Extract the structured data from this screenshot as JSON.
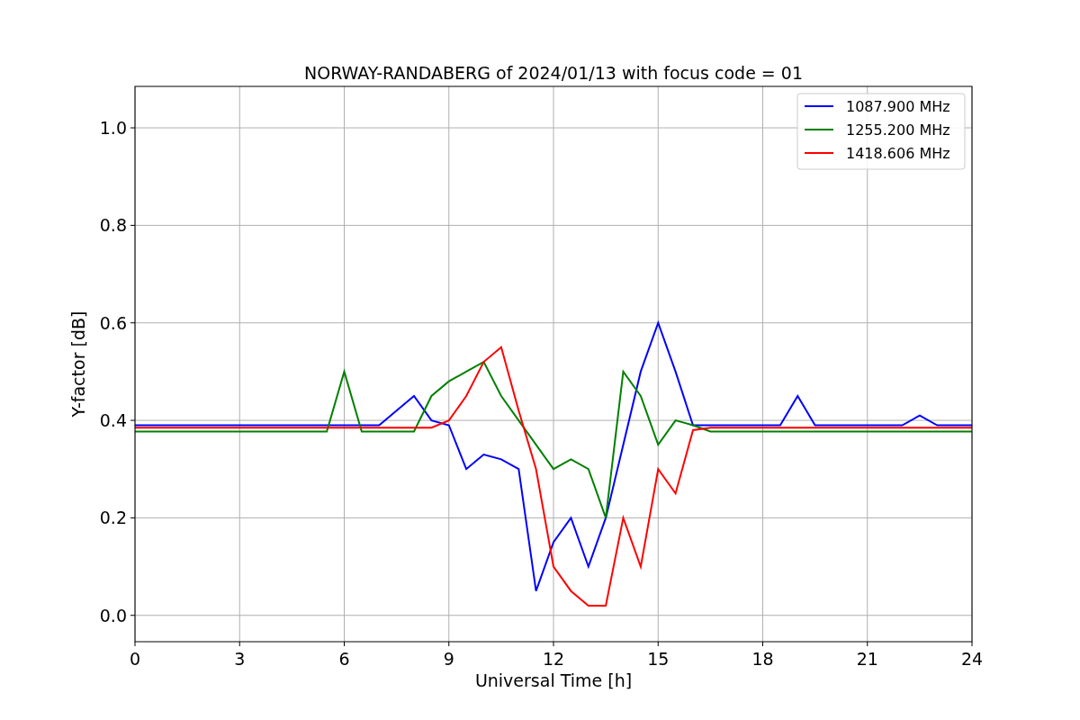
{
  "chart_data": {
    "type": "line",
    "title": "NORWAY-RANDABERG of 2024/01/13 with focus code = 01",
    "xlabel": "Universal Time [h]",
    "ylabel": "Y-factor [dB]",
    "x": [
      0,
      0.5,
      1,
      1.5,
      2,
      2.5,
      3,
      3.5,
      4,
      4.5,
      5,
      5.5,
      6,
      6.5,
      7,
      7.5,
      8,
      8.5,
      9,
      9.5,
      10,
      10.5,
      11,
      11.5,
      12,
      12.5,
      13,
      13.5,
      14,
      14.5,
      15,
      15.5,
      16,
      16.5,
      17,
      17.5,
      18,
      18.5,
      19,
      19.5,
      20,
      20.5,
      21,
      21.5,
      22,
      22.5,
      23,
      23.5,
      24
    ],
    "series": [
      {
        "name": "1087.900 MHz",
        "color": "#0000ff",
        "values": [
          0.39,
          0.39,
          0.39,
          0.39,
          0.39,
          0.39,
          0.39,
          0.39,
          0.39,
          0.39,
          0.39,
          0.39,
          0.39,
          0.39,
          0.39,
          0.42,
          0.45,
          0.4,
          0.39,
          0.3,
          0.33,
          0.32,
          0.3,
          0.05,
          0.15,
          0.2,
          0.1,
          0.2,
          0.35,
          0.5,
          0.6,
          0.5,
          0.39,
          0.39,
          0.39,
          0.39,
          0.39,
          0.39,
          0.45,
          0.39,
          0.39,
          0.39,
          0.39,
          0.39,
          0.39,
          0.41,
          0.39,
          0.39,
          0.39
        ]
      },
      {
        "name": "1255.200 MHz",
        "color": "#008000",
        "values": [
          0.377,
          0.377,
          0.377,
          0.377,
          0.377,
          0.377,
          0.377,
          0.377,
          0.377,
          0.377,
          0.377,
          0.377,
          0.5,
          0.377,
          0.377,
          0.377,
          0.377,
          0.45,
          0.48,
          0.5,
          0.52,
          0.45,
          0.4,
          0.35,
          0.3,
          0.32,
          0.3,
          0.2,
          0.5,
          0.45,
          0.35,
          0.4,
          0.39,
          0.377,
          0.377,
          0.377,
          0.377,
          0.377,
          0.377,
          0.377,
          0.377,
          0.377,
          0.377,
          0.377,
          0.377,
          0.377,
          0.377,
          0.377,
          0.377
        ]
      },
      {
        "name": "1418.606 MHz",
        "color": "#ff0000",
        "values": [
          0.385,
          0.385,
          0.385,
          0.385,
          0.385,
          0.385,
          0.385,
          0.385,
          0.385,
          0.385,
          0.385,
          0.385,
          0.385,
          0.385,
          0.385,
          0.385,
          0.385,
          0.385,
          0.4,
          0.45,
          0.52,
          0.55,
          0.42,
          0.3,
          0.1,
          0.05,
          0.02,
          0.02,
          0.2,
          0.1,
          0.3,
          0.25,
          0.38,
          0.385,
          0.385,
          0.385,
          0.385,
          0.385,
          0.385,
          0.385,
          0.385,
          0.385,
          0.385,
          0.385,
          0.385,
          0.385,
          0.385,
          0.385,
          0.385
        ]
      }
    ],
    "grid": true,
    "legend": "upper right",
    "xlim": [
      0,
      24
    ],
    "ylim": [
      -0.054,
      1.085
    ],
    "xticks": [
      0,
      3,
      6,
      9,
      12,
      15,
      18,
      21,
      24
    ],
    "yticks": [
      {
        "value": 0,
        "label": "0.0"
      },
      {
        "value": 0.2,
        "label": "0.2"
      },
      {
        "value": 0.4,
        "label": "0.4"
      },
      {
        "value": 0.6,
        "label": "0.6"
      },
      {
        "value": 0.8,
        "label": "0.8"
      },
      {
        "value": 1,
        "label": "1.0"
      }
    ]
  }
}
